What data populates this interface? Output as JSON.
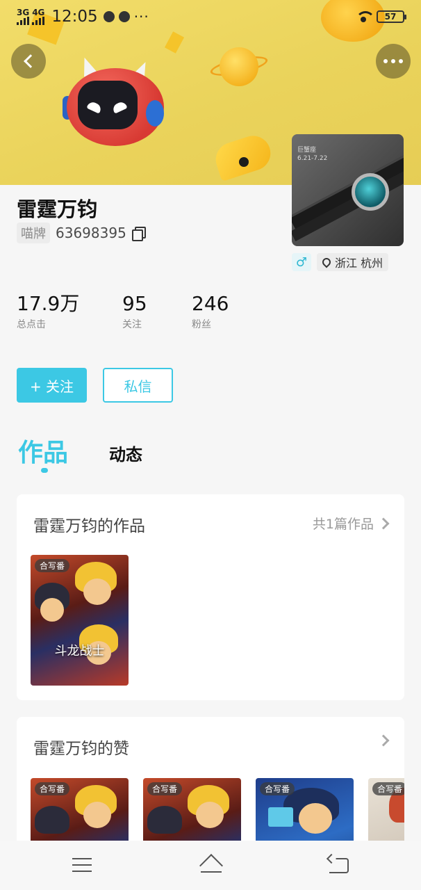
{
  "status_bar": {
    "network_1": "3G",
    "network_2": "4G",
    "time": "12:05",
    "overflow": "···",
    "battery": "57"
  },
  "profile": {
    "name": "雷霆万钧",
    "id_label": "喵牌",
    "id_number": "63698395",
    "gender_symbol": "♂",
    "location": "浙江 杭州",
    "avatar_caption": "巨蟹座\n6.21-7.22"
  },
  "stats": [
    {
      "value": "17.9万",
      "label": "总点击"
    },
    {
      "value": "95",
      "label": "关注"
    },
    {
      "value": "246",
      "label": "粉丝"
    }
  ],
  "actions": {
    "follow": "+ 关注",
    "message": "私信"
  },
  "tabs": {
    "works": "作品",
    "activity": "动态"
  },
  "works_card": {
    "title": "雷霆万钧的作品",
    "more": "共1篇作品",
    "items": [
      {
        "badge": "合写番",
        "title": "斗龙战士"
      }
    ]
  },
  "likes_card": {
    "title": "雷霆万钧的赞",
    "items": [
      {
        "badge": "合写番"
      },
      {
        "badge": "合写番"
      },
      {
        "badge": "合写番"
      },
      {
        "badge": "合写番"
      }
    ]
  },
  "colors": {
    "accent": "#3cc8e4",
    "banner": "#ead35b"
  }
}
